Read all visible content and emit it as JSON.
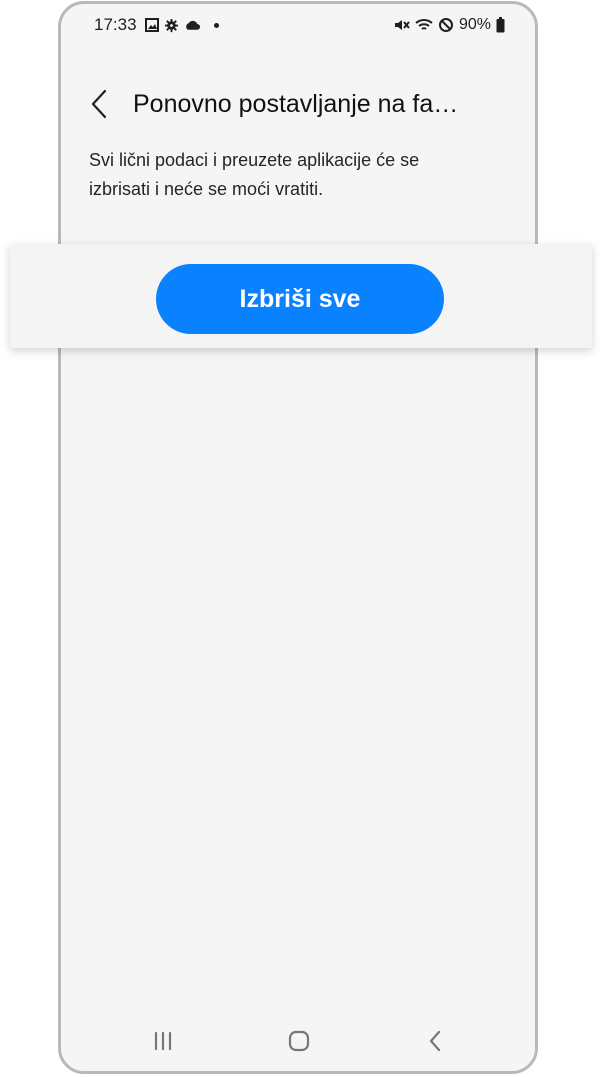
{
  "status_bar": {
    "time": "17:33",
    "battery_percent": "90%",
    "left_icons": [
      "gallery-icon",
      "settings-gear-icon",
      "cloud-icon",
      "notification-dot-icon"
    ],
    "right_icons": [
      "muted-speaker-icon",
      "wifi-icon",
      "do-not-disturb-icon",
      "battery-icon"
    ]
  },
  "header": {
    "title": "Ponovno postavljanje na fa…",
    "back_icon": "chevron-left-icon"
  },
  "content": {
    "description": "Svi lični podaci i preuzete aplikacije će se izbrisati i neće se moći vratiti."
  },
  "action": {
    "delete_all_label": "Izbriši sve",
    "button_color": "#0a82ff"
  },
  "navigation": {
    "items": [
      "recent-apps-icon",
      "home-icon",
      "back-icon"
    ]
  }
}
